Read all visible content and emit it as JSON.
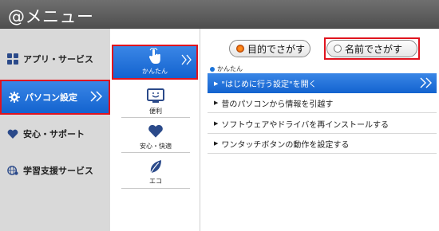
{
  "window": {
    "title": "@メニュー"
  },
  "sidebar": {
    "items": [
      {
        "label": "アプリ・サービス",
        "icon": "apps-grid-icon"
      },
      {
        "label": "パソコン設定",
        "icon": "gear-icon",
        "active": true
      },
      {
        "label": "安心・サポート",
        "icon": "heart-icon"
      },
      {
        "label": "学習支援サービス",
        "icon": "globe-icon"
      }
    ]
  },
  "subcategories": {
    "items": [
      {
        "label": "かんたん",
        "icon": "hand-tap-icon",
        "selected": true
      },
      {
        "label": "便利",
        "icon": "monitor-smile-icon"
      },
      {
        "label": "安心・快適",
        "icon": "heart-icon"
      },
      {
        "label": "エコ",
        "icon": "leaf-icon"
      }
    ]
  },
  "search_mode": {
    "purpose_label": "目的でさがす",
    "name_label": "名前でさがす",
    "selected": "purpose"
  },
  "section": {
    "label": "かんたん"
  },
  "actions": {
    "items": [
      {
        "label": "\"はじめに行う設定\"を開く",
        "highlighted": true
      },
      {
        "label": "昔のパソコンから情報を引越す"
      },
      {
        "label": "ソフトウェアやドライバを再インストールする"
      },
      {
        "label": "ワンタッチボタンの動作を設定する"
      }
    ]
  },
  "colors": {
    "accent_blue": "#1a6fdc",
    "highlight_red": "#e0141e",
    "radio_orange": "#f07a14"
  }
}
